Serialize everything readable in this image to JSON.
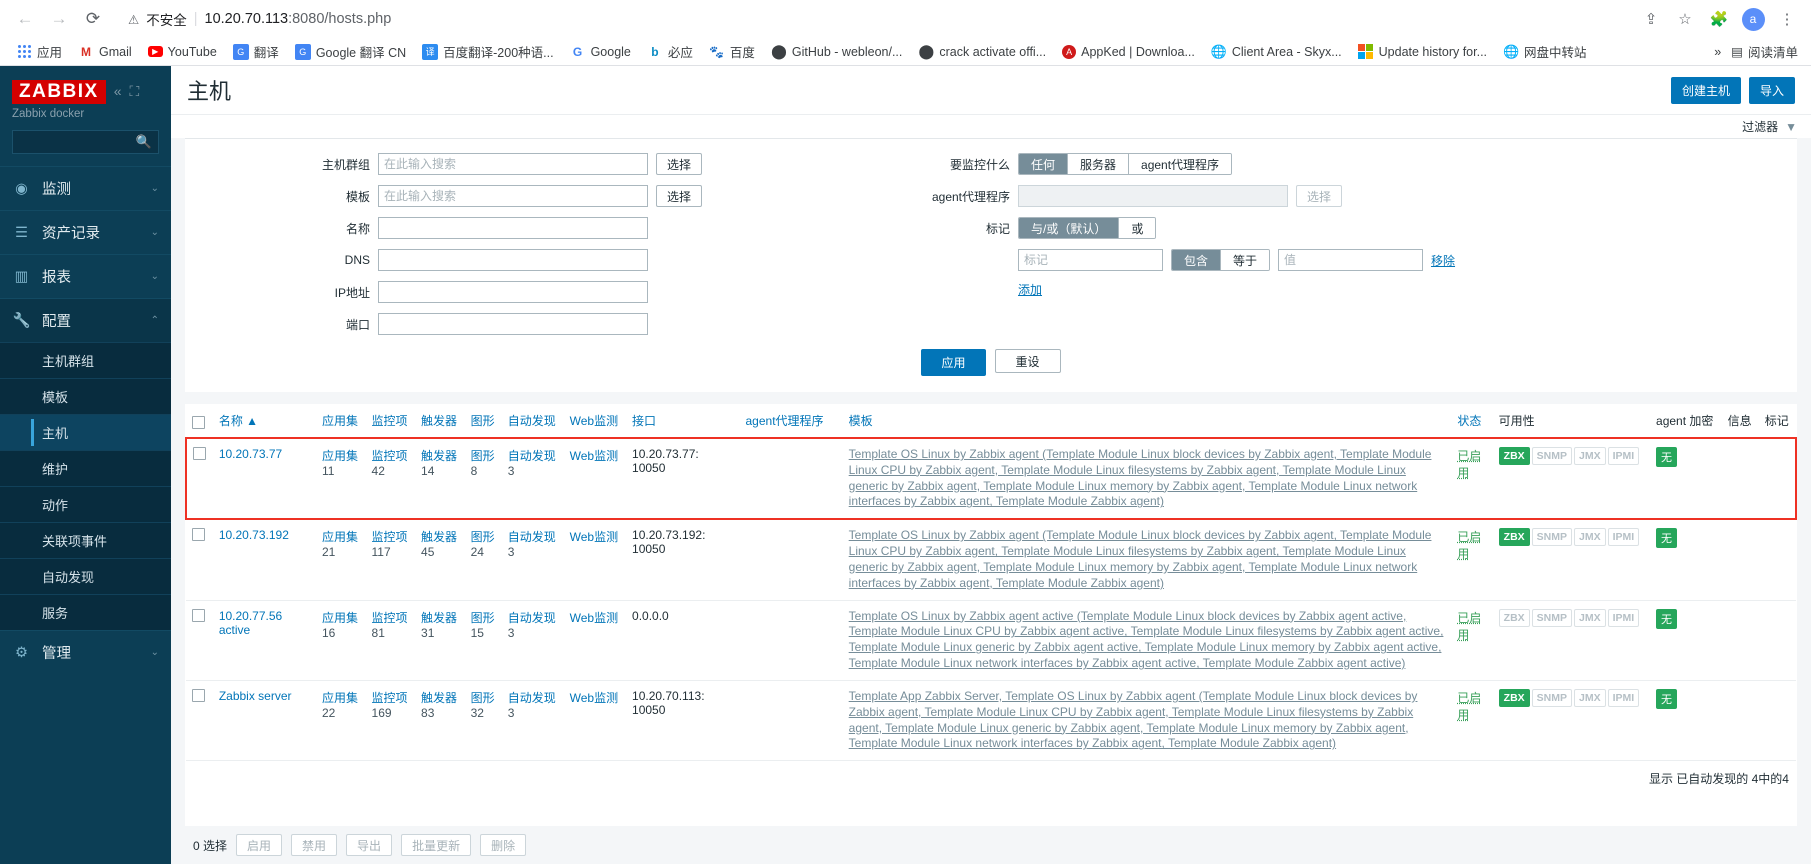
{
  "browser": {
    "back_icon": "arrow-left",
    "forward_icon": "arrow-right",
    "reload_icon": "reload",
    "security_warning_icon": "warning-triangle",
    "security_text": "不安全",
    "url_host": "10.20.70.113",
    "url_rest": ":8080/hosts.php",
    "share_icon": "share",
    "star_icon": "star",
    "extension_icon": "puzzle",
    "avatar_initial": "a",
    "menu_icon": "three-dots",
    "bookmarks": [
      {
        "label": "应用",
        "icon": "apps-grid"
      },
      {
        "label": "Gmail",
        "icon": "gmail-m"
      },
      {
        "label": "YouTube",
        "icon": "youtube-play"
      },
      {
        "label": "翻译",
        "icon": "google-translate"
      },
      {
        "label": "Google 翻译 CN",
        "icon": "google-translate"
      },
      {
        "label": "百度翻译-200种语...",
        "icon": "baidu-translate"
      },
      {
        "label": "Google",
        "icon": "google-g"
      },
      {
        "label": "必应",
        "icon": "bing-b"
      },
      {
        "label": "百度",
        "icon": "baidu-paw"
      },
      {
        "label": "GitHub - webleon/...",
        "icon": "github"
      },
      {
        "label": "crack activate offi...",
        "icon": "github"
      },
      {
        "label": "AppKed | Downloa...",
        "icon": "appked-a"
      },
      {
        "label": "Client Area - Skyx...",
        "icon": "globe"
      },
      {
        "label": "Update history for...",
        "icon": "microsoft-squares"
      },
      {
        "label": "网盘中转站",
        "icon": "globe"
      }
    ],
    "overflow_label": "»",
    "reading_list_icon": "reading-list",
    "reading_list_label": "阅读清单"
  },
  "sidebar": {
    "logo": "ZABBIX",
    "collapse_icon": "chevron-double-left",
    "expand_icon": "expand-box",
    "server_name": "Zabbix docker",
    "search_placeholder": "",
    "search_value": "",
    "search_icon": "search-icon",
    "items": [
      {
        "label": "监测",
        "icon": "eye-icon",
        "chevron": "⌄"
      },
      {
        "label": "资产记录",
        "icon": "list-icon",
        "chevron": "⌄"
      },
      {
        "label": "报表",
        "icon": "bar-chart-icon",
        "chevron": "⌄"
      },
      {
        "label": "配置",
        "icon": "wrench-icon",
        "chevron": "⌃"
      }
    ],
    "config_children": [
      "主机群组",
      "模板",
      "主机",
      "维护",
      "动作",
      "关联项事件",
      "自动发现",
      "服务"
    ],
    "selected_child": "主机",
    "admin": {
      "label": "管理",
      "icon": "gear-icon",
      "chevron": "⌄"
    }
  },
  "header": {
    "title": "主机",
    "create_host_label": "创建主机",
    "import_label": "导入"
  },
  "filter": {
    "tab_label": "过滤器",
    "funnel_icon": "funnel-icon",
    "host_group": {
      "label": "主机群组",
      "placeholder": "在此输入搜索",
      "value": "",
      "select_button": "选择"
    },
    "template": {
      "label": "模板",
      "placeholder": "在此输入搜索",
      "value": "",
      "select_button": "选择"
    },
    "name": {
      "label": "名称",
      "value": ""
    },
    "dns": {
      "label": "DNS",
      "value": ""
    },
    "ip": {
      "label": "IP地址",
      "value": ""
    },
    "port": {
      "label": "端口",
      "value": ""
    },
    "monitored_by": {
      "label": "要监控什么",
      "options": [
        "任何",
        "服务器",
        "agent代理程序"
      ],
      "selected": "任何"
    },
    "proxy": {
      "label": "agent代理程序",
      "value": "",
      "select_button": "选择"
    },
    "tags": {
      "label": "标记",
      "operator_options": [
        "与/或（默认）",
        "或"
      ],
      "operator_selected": "与/或（默认）",
      "tag_placeholder": "标记",
      "tag_value": "",
      "match_options": [
        "包含",
        "等于"
      ],
      "match_selected": "包含",
      "value_placeholder": "值",
      "value_value": "",
      "remove_label": "移除",
      "add_label": "添加"
    },
    "apply_label": "应用",
    "reset_label": "重设"
  },
  "table": {
    "columns": [
      "名称 ▲",
      "应用集",
      "监控项",
      "触发器",
      "图形",
      "自动发现",
      "Web监测",
      "接口",
      "agent代理程序",
      "模板",
      "状态",
      "可用性",
      "agent 加密",
      "信息",
      "标记"
    ],
    "col_name": "名称 ▲",
    "col_status": "状态",
    "col_availability": "可用性",
    "col_encryption": "agent 加密",
    "col_info": "信息",
    "col_tags": "标记",
    "link_labels": {
      "apps": "应用集",
      "items": "监控项",
      "triggers": "触发器",
      "graphs": "图形",
      "discovery": "自动发现",
      "web": "Web监测"
    },
    "availability_labels": [
      "ZBX",
      "SNMP",
      "JMX",
      "IPMI"
    ],
    "rows": [
      {
        "name": "10.20.73.77",
        "highlighted": true,
        "apps": "11",
        "items": "42",
        "triggers": "14",
        "graphs": "8",
        "discovery": "3",
        "interface": "10.20.73.77: 10050",
        "proxy": "",
        "templates": "Template OS Linux by Zabbix agent (Template Module Linux block devices by Zabbix agent, Template Module Linux CPU by Zabbix agent, Template Module Linux filesystems by Zabbix agent, Template Module Linux generic by Zabbix agent, Template Module Linux memory by Zabbix agent, Template Module Linux network interfaces by Zabbix agent, Template Module Zabbix agent)",
        "status": "已启用",
        "availability_active": [
          "ZBX"
        ],
        "encryption": "无"
      },
      {
        "name": "10.20.73.192",
        "highlighted": false,
        "apps": "21",
        "items": "117",
        "triggers": "45",
        "graphs": "24",
        "discovery": "3",
        "interface": "10.20.73.192: 10050",
        "proxy": "",
        "templates": "Template OS Linux by Zabbix agent (Template Module Linux block devices by Zabbix agent, Template Module Linux CPU by Zabbix agent, Template Module Linux filesystems by Zabbix agent, Template Module Linux generic by Zabbix agent, Template Module Linux memory by Zabbix agent, Template Module Linux network interfaces by Zabbix agent, Template Module Zabbix agent)",
        "status": "已启用",
        "availability_active": [
          "ZBX"
        ],
        "encryption": "无"
      },
      {
        "name": "10.20.77.56 active",
        "highlighted": false,
        "apps": "16",
        "items": "81",
        "triggers": "31",
        "graphs": "15",
        "discovery": "3",
        "interface": "0.0.0.0",
        "proxy": "",
        "templates": "Template OS Linux by Zabbix agent active (Template Module Linux block devices by Zabbix agent active, Template Module Linux CPU by Zabbix agent active, Template Module Linux filesystems by Zabbix agent active, Template Module Linux generic by Zabbix agent active, Template Module Linux memory by Zabbix agent active, Template Module Linux network interfaces by Zabbix agent active, Template Module Zabbix agent active)",
        "status": "已启用",
        "availability_active": [],
        "encryption": "无"
      },
      {
        "name": "Zabbix server",
        "highlighted": false,
        "apps": "22",
        "items": "169",
        "triggers": "83",
        "graphs": "32",
        "discovery": "3",
        "interface": "10.20.70.113: 10050",
        "proxy": "",
        "templates": "Template App Zabbix Server, Template OS Linux by Zabbix agent (Template Module Linux block devices by Zabbix agent, Template Module Linux CPU by Zabbix agent, Template Module Linux filesystems by Zabbix agent, Template Module Linux generic by Zabbix agent, Template Module Linux memory by Zabbix agent, Template Module Linux network interfaces by Zabbix agent, Template Module Zabbix agent)",
        "status": "已启用",
        "availability_active": [
          "ZBX"
        ],
        "encryption": "无"
      }
    ],
    "footer_text": "显示 已自动发现的 4中的4"
  },
  "bottom_bar": {
    "selected_text": "0 选择",
    "buttons": [
      "启用",
      "禁用",
      "导出",
      "批量更新",
      "删除"
    ]
  }
}
